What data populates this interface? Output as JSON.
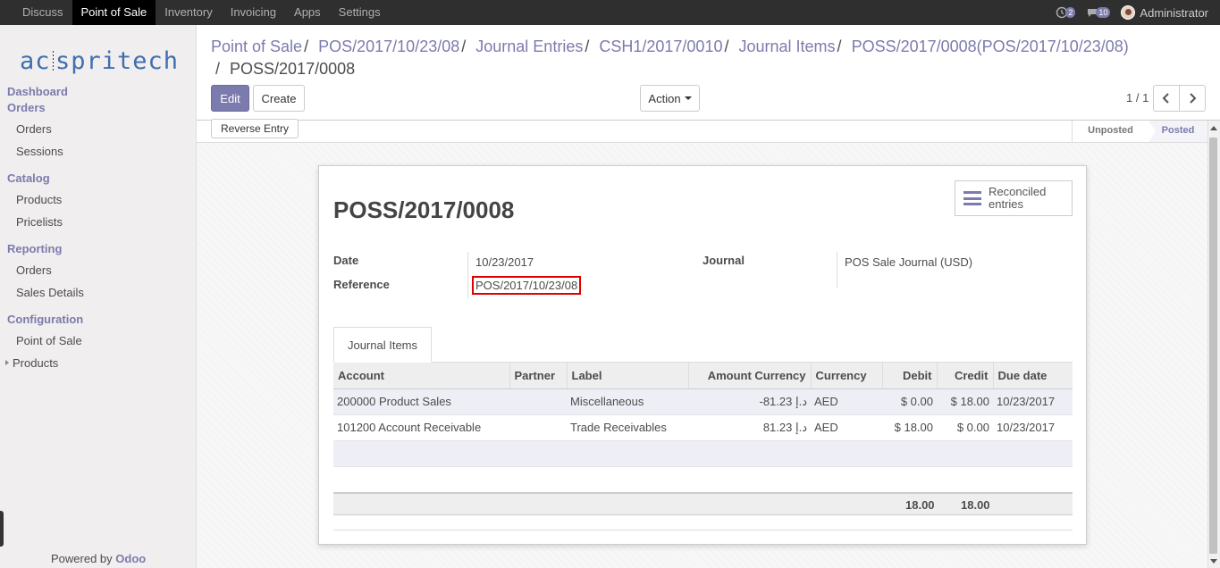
{
  "topbar": {
    "menus": [
      "Discuss",
      "Point of Sale",
      "Inventory",
      "Invoicing",
      "Apps",
      "Settings"
    ],
    "activity_count": "2",
    "message_count": "10",
    "user": "Administrator"
  },
  "sidebar": {
    "logo_left": "ac",
    "logo_right": "spritech",
    "dashboard": "Dashboard",
    "orders_section": "Orders",
    "orders": "Orders",
    "sessions": "Sessions",
    "catalog_section": "Catalog",
    "products": "Products",
    "pricelists": "Pricelists",
    "reporting_section": "Reporting",
    "reporting_orders": "Orders",
    "sales_details": "Sales Details",
    "configuration_section": "Configuration",
    "point_of_sale": "Point of Sale",
    "config_products": "Products",
    "powered_by": "Powered by",
    "odoo": "Odoo"
  },
  "breadcrumb": {
    "items": [
      "Point of Sale",
      "POS/2017/10/23/08",
      "Journal Entries",
      "CSH1/2017/0010",
      "Journal Items",
      "POSS/2017/0008(POS/2017/10/23/08)"
    ],
    "current": "POSS/2017/0008"
  },
  "toolbar": {
    "edit": "Edit",
    "create": "Create",
    "action": "Action",
    "pager": "1 / 1",
    "reverse_entry": "Reverse Entry"
  },
  "status": {
    "unposted": "Unposted",
    "posted": "Posted"
  },
  "form": {
    "title": "POSS/2017/0008",
    "smart_button": "Reconciled entries",
    "date_label": "Date",
    "date_value": "10/23/2017",
    "reference_label": "Reference",
    "reference_value": "POS/2017/10/23/08",
    "journal_label": "Journal",
    "journal_value": "POS Sale Journal (USD)",
    "tab": "Journal Items"
  },
  "table": {
    "headers": [
      "Account",
      "Partner",
      "Label",
      "Amount Currency",
      "Currency",
      "Debit",
      "Credit",
      "Due date"
    ],
    "rows": [
      [
        "200000 Product Sales",
        "",
        "Miscellaneous",
        "-81.23 د.إ",
        "AED",
        "$ 0.00",
        "$ 18.00",
        "10/23/2017"
      ],
      [
        "101200 Account Receivable",
        "",
        "Trade Receivables",
        "81.23 د.إ",
        "AED",
        "$ 18.00",
        "$ 0.00",
        "10/23/2017"
      ]
    ],
    "total_debit": "18.00",
    "total_credit": "18.00"
  }
}
